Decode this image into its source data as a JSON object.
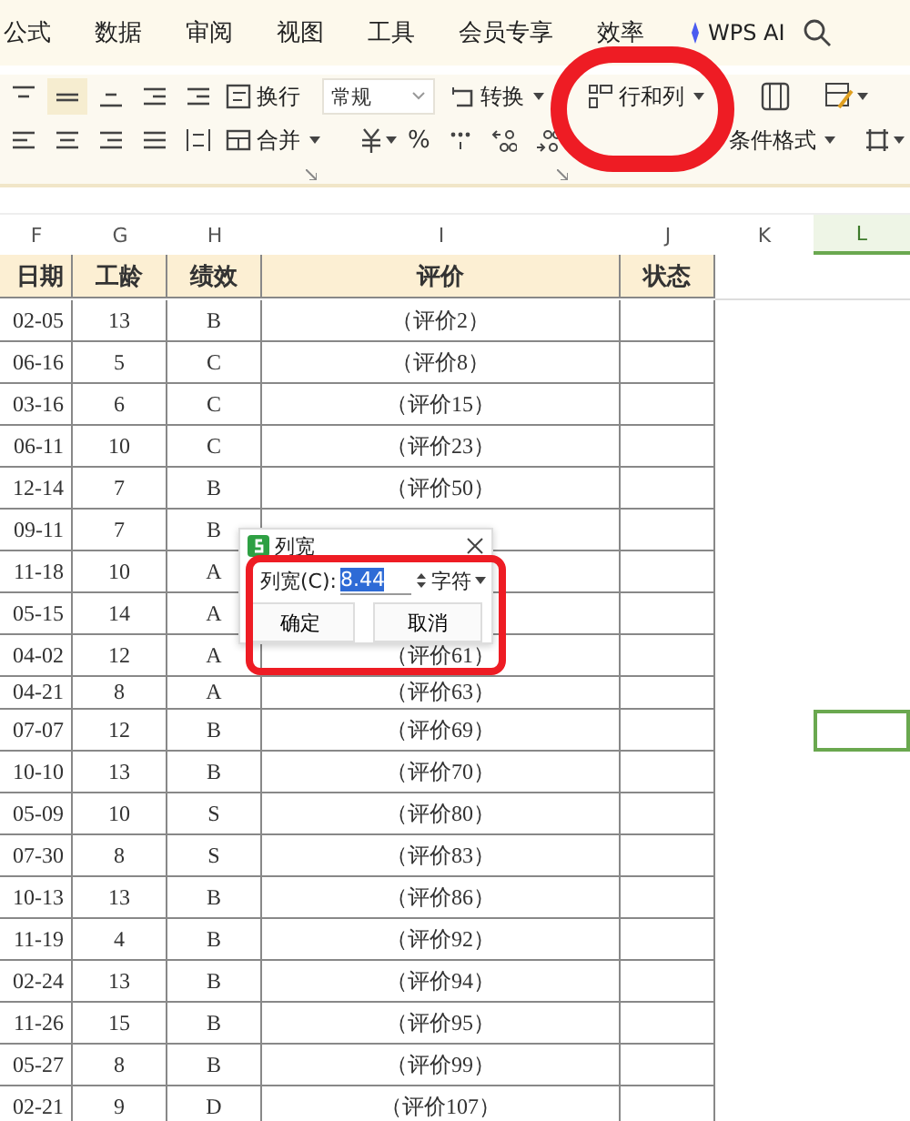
{
  "menu_tabs": [
    {
      "label": "公式",
      "kind": "text"
    },
    {
      "label": "数据",
      "kind": "text"
    },
    {
      "label": "审阅",
      "kind": "text"
    },
    {
      "label": "视图",
      "kind": "text"
    },
    {
      "label": "工具",
      "kind": "text"
    },
    {
      "label": "会员专享",
      "kind": "text"
    },
    {
      "label": "效率",
      "kind": "text"
    },
    {
      "label": "WPS AI",
      "kind": "ai"
    }
  ],
  "ribbon": {
    "wrap_button": "换行",
    "merge_button": "合并",
    "number_format": "常规",
    "convert_button": "转换",
    "rows_columns_button": "行和列",
    "conditional_format_button": "条件格式",
    "percent": "%"
  },
  "sheet": {
    "columns": [
      {
        "letter": "F",
        "selected": false
      },
      {
        "letter": "G",
        "selected": false
      },
      {
        "letter": "H",
        "selected": false
      },
      {
        "letter": "I",
        "selected": false
      },
      {
        "letter": "J",
        "selected": false
      },
      {
        "letter": "K",
        "selected": false
      },
      {
        "letter": "L",
        "selected": true
      }
    ],
    "headers": [
      "日期",
      "工龄",
      "绩效",
      "评价",
      "状态"
    ],
    "rows": [
      {
        "cells": [
          "02-05",
          "13",
          "B",
          "（评价2）"
        ],
        "selected": false
      },
      {
        "cells": [
          "06-16",
          "5",
          "C",
          "（评价8）"
        ],
        "selected": false
      },
      {
        "cells": [
          "03-16",
          "6",
          "C",
          "（评价15）"
        ],
        "selected": false
      },
      {
        "cells": [
          "06-11",
          "10",
          "C",
          "（评价23）"
        ],
        "selected": false
      },
      {
        "cells": [
          "12-14",
          "7",
          "B",
          "（评价50）"
        ],
        "selected": false
      },
      {
        "cells": [
          "09-11",
          "7",
          "B"
        ],
        "selected": false
      },
      {
        "cells": [
          "11-18",
          "10",
          "A"
        ],
        "selected": false
      },
      {
        "cells": [
          "05-15",
          "14",
          "A"
        ],
        "selected": false
      },
      {
        "cells": [
          "04-02",
          "12",
          "A",
          "（评价61）"
        ],
        "selected": false
      },
      {
        "cells": [
          "04-21",
          "8",
          "A",
          "（评价63）"
        ],
        "selected": false
      },
      {
        "cells": [
          "07-07",
          "12",
          "B",
          "（评价69）"
        ],
        "selected": true
      },
      {
        "cells": [
          "10-10",
          "13",
          "B",
          "（评价70）"
        ],
        "selected": false
      },
      {
        "cells": [
          "05-09",
          "10",
          "S",
          "（评价80）"
        ],
        "selected": false
      },
      {
        "cells": [
          "07-30",
          "8",
          "S",
          "（评价83）"
        ],
        "selected": false
      },
      {
        "cells": [
          "10-13",
          "13",
          "B",
          "（评价86）"
        ],
        "selected": false
      },
      {
        "cells": [
          "11-19",
          "4",
          "B",
          "（评价92）"
        ],
        "selected": false
      },
      {
        "cells": [
          "02-24",
          "13",
          "B",
          "（评价94）"
        ],
        "selected": false
      },
      {
        "cells": [
          "11-26",
          "15",
          "B",
          "（评价95）"
        ],
        "selected": false
      },
      {
        "cells": [
          "05-27",
          "8",
          "B",
          "（评价99）"
        ],
        "selected": false
      },
      {
        "cells": [
          "02-21",
          "9",
          "D",
          "（评价107）"
        ],
        "selected": false
      }
    ]
  },
  "dialog": {
    "title": "列宽",
    "label": "列宽(C):",
    "value": "8.44",
    "unit": "字符",
    "buttons": [
      "确定",
      "取消"
    ]
  },
  "ink_marks": [
    {
      "kind": "circle"
    },
    {
      "kind": "circle"
    }
  ]
}
